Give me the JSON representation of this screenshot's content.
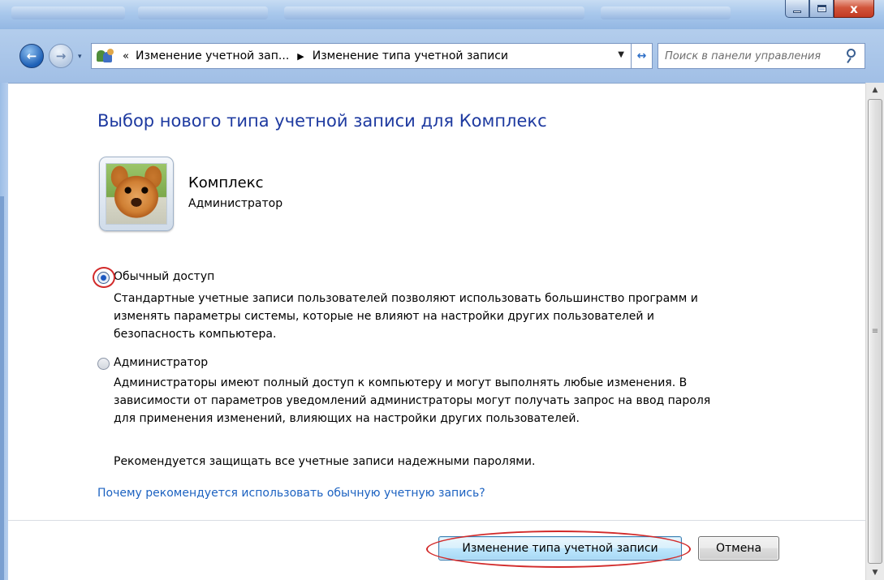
{
  "window": {
    "minimize_icon": "minimize-icon",
    "maximize_icon": "maximize-icon",
    "close_label": "x"
  },
  "nav": {
    "back_glyph": "←",
    "forward_glyph": "→",
    "dropdown_glyph": "▾"
  },
  "address": {
    "overflow": "«",
    "crumb1": "Изменение учетной зап...",
    "separator": "▶",
    "crumb2": "Изменение типа учетной записи",
    "dropdown": "▼",
    "refresh_glyph": "↔"
  },
  "search": {
    "placeholder": "Поиск в панели управления"
  },
  "page": {
    "title": "Выбор нового типа учетной записи для Комплекс",
    "user_name": "Комплекс",
    "user_role": "Администратор",
    "options": [
      {
        "label": "Обычный доступ",
        "checked": true,
        "description": [
          "Стандартные учетные записи пользователей позволяют использовать большинство программ и",
          "изменять параметры системы, которые не влияют на настройки других пользователей и",
          "безопасность компьютера."
        ]
      },
      {
        "label": "Администратор",
        "checked": false,
        "description": [
          "Администраторы имеют полный доступ к компьютеру и могут выполнять любые изменения. В",
          "зависимости от параметров уведомлений администраторы могут получать запрос на ввод пароля",
          "для применения изменений, влияющих на настройки других пользователей."
        ]
      }
    ],
    "recommend": "Рекомендуется защищать все учетные записи надежными паролями.",
    "why_link": "Почему рекомендуется использовать обычную учетную запись?"
  },
  "buttons": {
    "change": "Изменение типа учетной записи",
    "cancel": "Отмена"
  },
  "scrollbar": {
    "up": "▲",
    "down": "▼",
    "grip": "≡"
  },
  "colors": {
    "title": "#1e3aa0",
    "link": "#1c62c1",
    "highlight": "#d22a2a"
  }
}
